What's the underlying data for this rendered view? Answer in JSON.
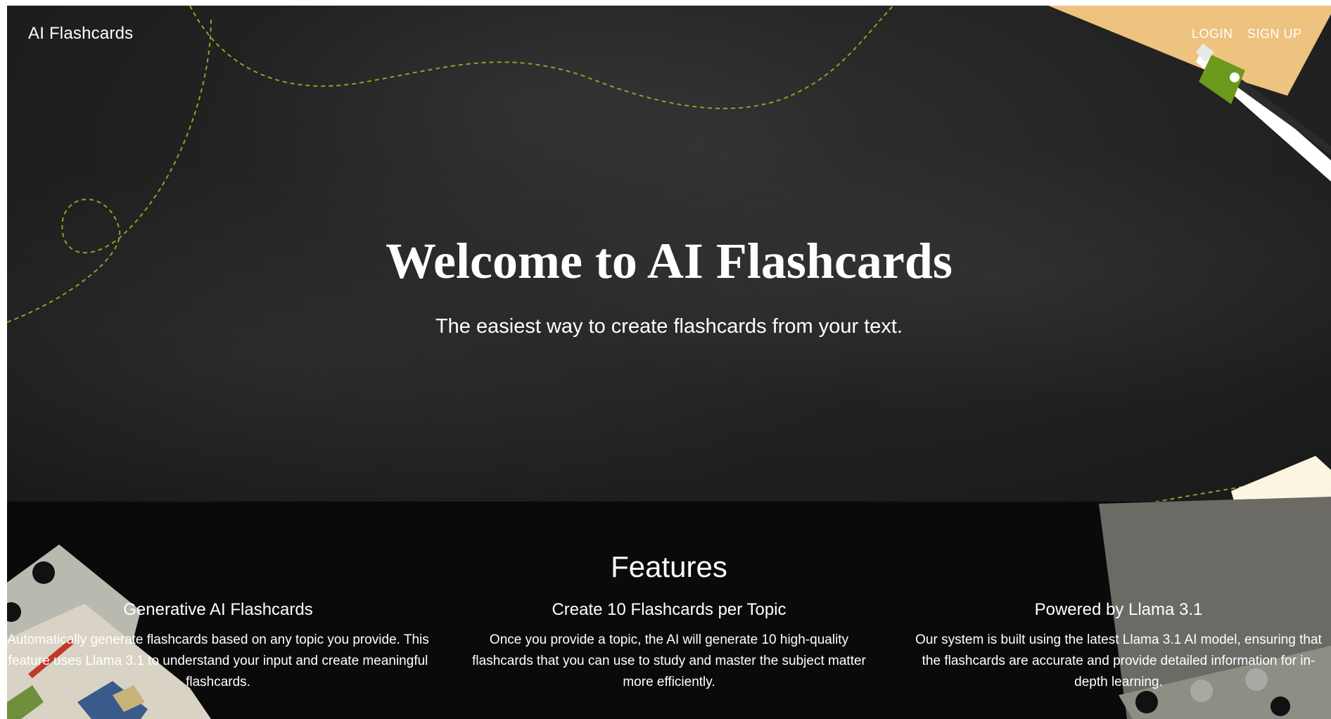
{
  "navbar": {
    "brand": "AI Flashcards",
    "login_label": "LOGIN",
    "signup_label": "SIGN UP"
  },
  "hero": {
    "title": "Welcome to AI Flashcards",
    "subtitle": "The easiest way to create flashcards from your text."
  },
  "features": {
    "heading": "Features",
    "items": [
      {
        "title": "Generative AI Flashcards",
        "description": "Automatically generate flashcards based on any topic you provide. This feature uses Llama 3.1 to understand your input and create meaningful flashcards."
      },
      {
        "title": "Create 10 Flashcards per Topic",
        "description": "Once you provide a topic, the AI will generate 10 high-quality flashcards that you can use to study and master the subject matter more efficiently."
      },
      {
        "title": "Powered by Llama 3.1",
        "description": "Our system is built using the latest Llama 3.1 AI model, ensuring that the flashcards are accurate and provide detailed information for in-depth learning."
      }
    ]
  },
  "colors": {
    "chalkboard": "#222322",
    "features_bg": "#0a0a0a",
    "text": "#ffffff",
    "accent_orange": "#eec27f",
    "accent_green": "#6b9a1c",
    "dashed_line": "#8ea22a"
  }
}
